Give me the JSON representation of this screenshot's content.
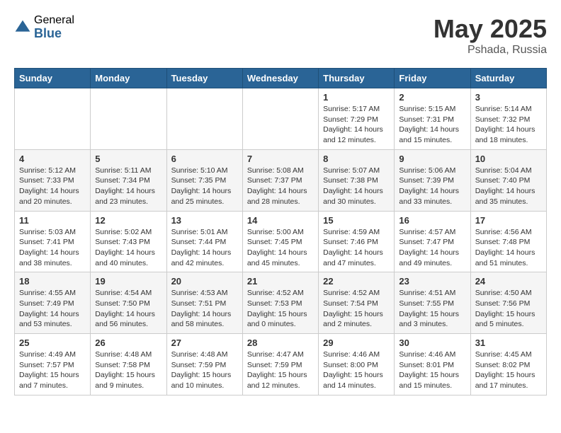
{
  "header": {
    "logo_general": "General",
    "logo_blue": "Blue",
    "title": "May 2025",
    "location": "Pshada, Russia"
  },
  "weekdays": [
    "Sunday",
    "Monday",
    "Tuesday",
    "Wednesday",
    "Thursday",
    "Friday",
    "Saturday"
  ],
  "weeks": [
    [
      {
        "day": "",
        "info": ""
      },
      {
        "day": "",
        "info": ""
      },
      {
        "day": "",
        "info": ""
      },
      {
        "day": "",
        "info": ""
      },
      {
        "day": "1",
        "info": "Sunrise: 5:17 AM\nSunset: 7:29 PM\nDaylight: 14 hours\nand 12 minutes."
      },
      {
        "day": "2",
        "info": "Sunrise: 5:15 AM\nSunset: 7:31 PM\nDaylight: 14 hours\nand 15 minutes."
      },
      {
        "day": "3",
        "info": "Sunrise: 5:14 AM\nSunset: 7:32 PM\nDaylight: 14 hours\nand 18 minutes."
      }
    ],
    [
      {
        "day": "4",
        "info": "Sunrise: 5:12 AM\nSunset: 7:33 PM\nDaylight: 14 hours\nand 20 minutes."
      },
      {
        "day": "5",
        "info": "Sunrise: 5:11 AM\nSunset: 7:34 PM\nDaylight: 14 hours\nand 23 minutes."
      },
      {
        "day": "6",
        "info": "Sunrise: 5:10 AM\nSunset: 7:35 PM\nDaylight: 14 hours\nand 25 minutes."
      },
      {
        "day": "7",
        "info": "Sunrise: 5:08 AM\nSunset: 7:37 PM\nDaylight: 14 hours\nand 28 minutes."
      },
      {
        "day": "8",
        "info": "Sunrise: 5:07 AM\nSunset: 7:38 PM\nDaylight: 14 hours\nand 30 minutes."
      },
      {
        "day": "9",
        "info": "Sunrise: 5:06 AM\nSunset: 7:39 PM\nDaylight: 14 hours\nand 33 minutes."
      },
      {
        "day": "10",
        "info": "Sunrise: 5:04 AM\nSunset: 7:40 PM\nDaylight: 14 hours\nand 35 minutes."
      }
    ],
    [
      {
        "day": "11",
        "info": "Sunrise: 5:03 AM\nSunset: 7:41 PM\nDaylight: 14 hours\nand 38 minutes."
      },
      {
        "day": "12",
        "info": "Sunrise: 5:02 AM\nSunset: 7:43 PM\nDaylight: 14 hours\nand 40 minutes."
      },
      {
        "day": "13",
        "info": "Sunrise: 5:01 AM\nSunset: 7:44 PM\nDaylight: 14 hours\nand 42 minutes."
      },
      {
        "day": "14",
        "info": "Sunrise: 5:00 AM\nSunset: 7:45 PM\nDaylight: 14 hours\nand 45 minutes."
      },
      {
        "day": "15",
        "info": "Sunrise: 4:59 AM\nSunset: 7:46 PM\nDaylight: 14 hours\nand 47 minutes."
      },
      {
        "day": "16",
        "info": "Sunrise: 4:57 AM\nSunset: 7:47 PM\nDaylight: 14 hours\nand 49 minutes."
      },
      {
        "day": "17",
        "info": "Sunrise: 4:56 AM\nSunset: 7:48 PM\nDaylight: 14 hours\nand 51 minutes."
      }
    ],
    [
      {
        "day": "18",
        "info": "Sunrise: 4:55 AM\nSunset: 7:49 PM\nDaylight: 14 hours\nand 53 minutes."
      },
      {
        "day": "19",
        "info": "Sunrise: 4:54 AM\nSunset: 7:50 PM\nDaylight: 14 hours\nand 56 minutes."
      },
      {
        "day": "20",
        "info": "Sunrise: 4:53 AM\nSunset: 7:51 PM\nDaylight: 14 hours\nand 58 minutes."
      },
      {
        "day": "21",
        "info": "Sunrise: 4:52 AM\nSunset: 7:53 PM\nDaylight: 15 hours\nand 0 minutes."
      },
      {
        "day": "22",
        "info": "Sunrise: 4:52 AM\nSunset: 7:54 PM\nDaylight: 15 hours\nand 2 minutes."
      },
      {
        "day": "23",
        "info": "Sunrise: 4:51 AM\nSunset: 7:55 PM\nDaylight: 15 hours\nand 3 minutes."
      },
      {
        "day": "24",
        "info": "Sunrise: 4:50 AM\nSunset: 7:56 PM\nDaylight: 15 hours\nand 5 minutes."
      }
    ],
    [
      {
        "day": "25",
        "info": "Sunrise: 4:49 AM\nSunset: 7:57 PM\nDaylight: 15 hours\nand 7 minutes."
      },
      {
        "day": "26",
        "info": "Sunrise: 4:48 AM\nSunset: 7:58 PM\nDaylight: 15 hours\nand 9 minutes."
      },
      {
        "day": "27",
        "info": "Sunrise: 4:48 AM\nSunset: 7:59 PM\nDaylight: 15 hours\nand 10 minutes."
      },
      {
        "day": "28",
        "info": "Sunrise: 4:47 AM\nSunset: 7:59 PM\nDaylight: 15 hours\nand 12 minutes."
      },
      {
        "day": "29",
        "info": "Sunrise: 4:46 AM\nSunset: 8:00 PM\nDaylight: 15 hours\nand 14 minutes."
      },
      {
        "day": "30",
        "info": "Sunrise: 4:46 AM\nSunset: 8:01 PM\nDaylight: 15 hours\nand 15 minutes."
      },
      {
        "day": "31",
        "info": "Sunrise: 4:45 AM\nSunset: 8:02 PM\nDaylight: 15 hours\nand 17 minutes."
      }
    ]
  ]
}
